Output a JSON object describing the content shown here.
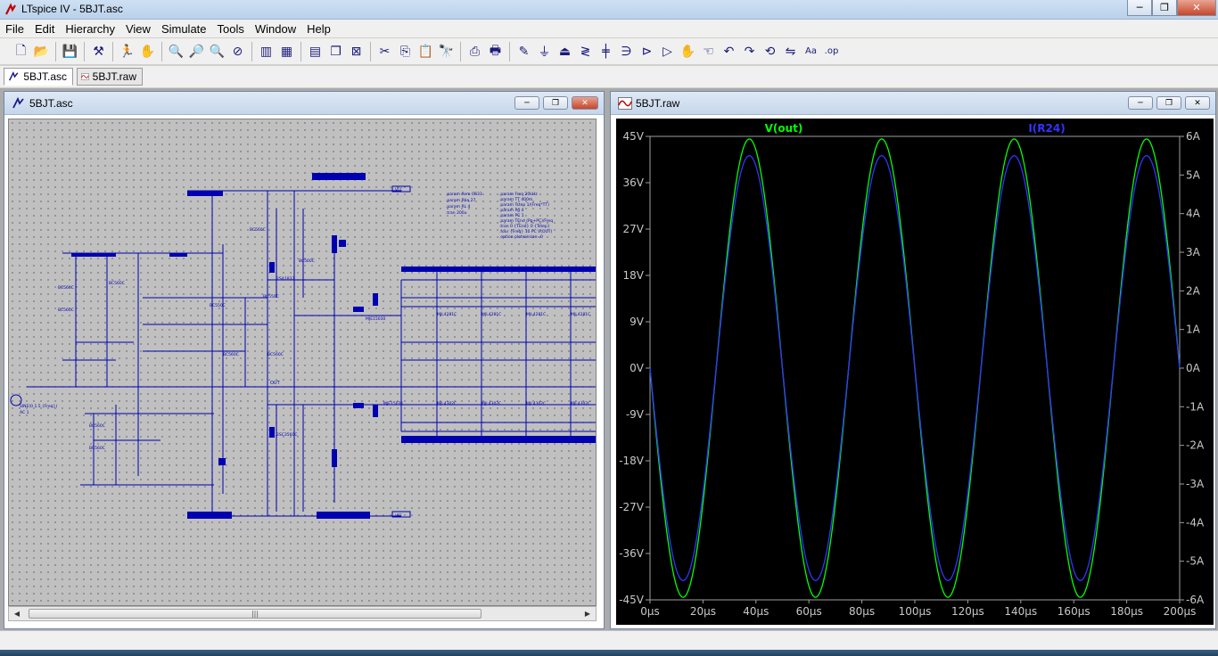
{
  "app": {
    "title": "LTspice IV - 5BJT.asc",
    "minimize_glyph": "─",
    "maximize_glyph": "❐",
    "close_glyph": "✕"
  },
  "menu": [
    "File",
    "Edit",
    "Hierarchy",
    "View",
    "Simulate",
    "Tools",
    "Window",
    "Help"
  ],
  "toolbar": {
    "groups": [
      [
        "new-schematic-icon",
        "open-icon"
      ],
      [
        "save-icon"
      ],
      [
        "control-panel-icon"
      ],
      [
        "run-icon",
        "halt-icon"
      ],
      [
        "zoom-in-icon",
        "zoom-pan-icon",
        "zoom-out-icon",
        "zoom-cancel-icon"
      ],
      [
        "autorange-icon",
        "mark-unused-icon"
      ],
      [
        "tile-horizontal-icon",
        "cascade-icon",
        "close-window-icon"
      ],
      [
        "cut-icon",
        "copy-icon",
        "paste-icon",
        "find-icon"
      ],
      [
        "print-setup-icon",
        "print-icon"
      ],
      [
        "wire-icon",
        "ground-icon",
        "label-net-icon",
        "resistor-icon",
        "capacitor-icon",
        "inductor-icon",
        "diode-icon",
        "component-icon",
        "move-icon",
        "drag-icon",
        "undo-icon",
        "redo-icon",
        "rotate-icon",
        "mirror-icon",
        "text-icon",
        "spice-directive-icon"
      ]
    ],
    "glyphs": {
      "new-schematic-icon": "🗋",
      "open-icon": "📂",
      "save-icon": "💾",
      "control-panel-icon": "⚒",
      "run-icon": "🏃",
      "halt-icon": "✋",
      "zoom-in-icon": "🔍",
      "zoom-pan-icon": "🔎",
      "zoom-out-icon": "🔍",
      "zoom-cancel-icon": "⊘",
      "autorange-icon": "▥",
      "mark-unused-icon": "▦",
      "tile-horizontal-icon": "▤",
      "cascade-icon": "❐",
      "close-window-icon": "⊠",
      "cut-icon": "✂",
      "copy-icon": "⎘",
      "paste-icon": "📋",
      "find-icon": "🔭",
      "print-setup-icon": "⎙",
      "print-icon": "🖶",
      "wire-icon": "✎",
      "ground-icon": "⏚",
      "label-net-icon": "⏏",
      "resistor-icon": "≷",
      "capacitor-icon": "╪",
      "inductor-icon": "∋",
      "diode-icon": "⊳",
      "component-icon": "▷",
      "move-icon": "✋",
      "drag-icon": "☜",
      "undo-icon": "↶",
      "redo-icon": "↷",
      "rotate-icon": "⟲",
      "mirror-icon": "⇋",
      "text-icon": "Aa",
      "spice-directive-icon": ".op"
    }
  },
  "tabs": [
    {
      "label": "5BJT.asc",
      "active": true
    },
    {
      "label": "5BJT.raw",
      "active": false
    }
  ],
  "schematic_window": {
    "title": "5BJT.asc",
    "directives_left": [
      ".param Rem 0R33",
      ".param Rba 27",
      ".param RL 4",
      ".tran 200u"
    ],
    "directives_right": [
      ".param Freq 20kHz",
      ".param TT 400m",
      ".param Tstep 1/(Freq*TT)",
      ".param Pg 4",
      ".param PC 1",
      ".param TEnd (Pg+PC)/Freq",
      ".tran 0 {TEnd} 0 {Tstep}",
      ".four {Freq} 10 PC V(OUT)",
      ".option plotwinsize=0"
    ],
    "labels": {
      "out": "OUT",
      "source": "SINE(0 1.5 {Freq})",
      "ac": "AC 1",
      "vcc": "VCC",
      "vee": "VEE"
    }
  },
  "waveform_window": {
    "title": "5BJT.raw"
  },
  "chart_data": {
    "type": "line",
    "title": "",
    "x": [
      0,
      12.5,
      37.5,
      62.5,
      87.5,
      112.5,
      137.5,
      162.5,
      187.5,
      200
    ],
    "x_unit": "µs",
    "x_ticks": [
      "0µs",
      "20µs",
      "40µs",
      "60µs",
      "80µs",
      "100µs",
      "120µs",
      "140µs",
      "160µs",
      "180µs",
      "200µs"
    ],
    "xlim": [
      0,
      200
    ],
    "y_left_ticks": [
      "45V",
      "36V",
      "27V",
      "18V",
      "9V",
      "0V",
      "-9V",
      "-18V",
      "-27V",
      "-36V",
      "-45V"
    ],
    "y_right_ticks": [
      "6A",
      "5A",
      "4A",
      "3A",
      "2A",
      "1A",
      "0A",
      "-1A",
      "-2A",
      "-3A",
      "-4A",
      "-5A",
      "-6A"
    ],
    "ylim_left": [
      -45,
      45
    ],
    "ylim_right": [
      -6,
      6
    ],
    "frequency_hz": 20000,
    "series": [
      {
        "name": "V(out)",
        "axis": "left",
        "color": "#00ff00",
        "amplitude": 44.5,
        "values": [
          0,
          -44.5,
          44.5,
          -44.5,
          44.5,
          -44.5,
          44.5,
          -44.5,
          44.5,
          0
        ]
      },
      {
        "name": "I(R24)",
        "axis": "right",
        "color": "#3333ff",
        "amplitude": 5.5,
        "values": [
          0,
          -5.5,
          5.5,
          -5.5,
          5.5,
          -5.5,
          5.5,
          -5.5,
          5.5,
          0
        ]
      }
    ],
    "grid": false,
    "legend": "top"
  }
}
